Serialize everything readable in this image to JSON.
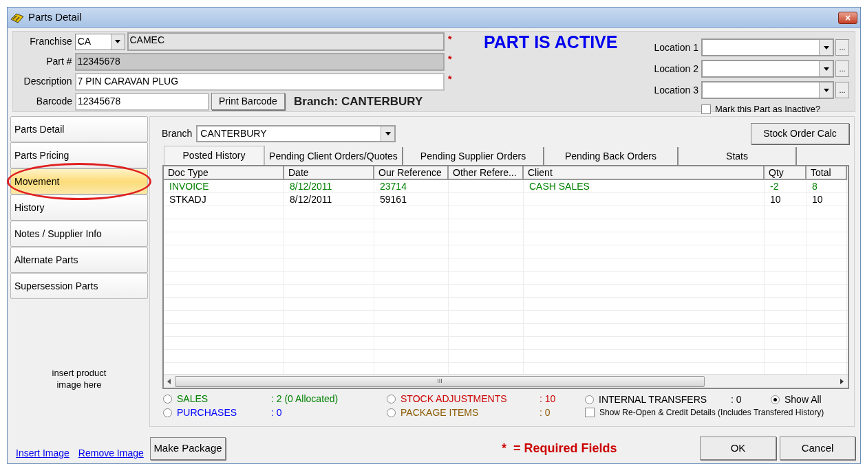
{
  "window": {
    "title": "Parts Detail",
    "close": "×"
  },
  "header": {
    "required_mark": "*",
    "franchise": {
      "label": "Franchise",
      "code": "CA",
      "name": "CAMEC",
      "required": true
    },
    "part_number": {
      "label": "Part #",
      "value": "12345678",
      "required": true
    },
    "description": {
      "label": "Description",
      "value": "7 PIN CARAVAN PLUG",
      "required": true
    },
    "barcode": {
      "label": "Barcode",
      "value": "12345678"
    },
    "print_barcode": "Print Barcode",
    "branch_text": "Branch: CANTERBURY",
    "status": "PART IS ACTIVE",
    "locations": [
      {
        "label": "Location 1",
        "browse": "..."
      },
      {
        "label": "Location 2",
        "browse": "..."
      },
      {
        "label": "Location 3",
        "browse": "..."
      }
    ],
    "inactive": {
      "label": "Mark this Part as Inactive?",
      "checked": false
    }
  },
  "sidebar": {
    "items": [
      {
        "label": "Parts Detail",
        "selected": false
      },
      {
        "label": "Parts Pricing",
        "selected": false
      },
      {
        "label": "Movement",
        "selected": true,
        "circled": true
      },
      {
        "label": "History",
        "selected": false
      },
      {
        "label": "Notes / Supplier Info",
        "selected": false
      },
      {
        "label": "Alternate Parts",
        "selected": false
      },
      {
        "label": "Supersession Parts",
        "selected": false
      }
    ],
    "image_placeholder": [
      "insert product",
      "image here"
    ],
    "links": [
      "Insert Image",
      "Remove Image"
    ]
  },
  "branch": {
    "label": "Branch",
    "value": "CANTERBURY"
  },
  "stock_order_calc": "Stock Order Calc",
  "tabs": [
    {
      "label": "Posted History",
      "selected": true
    },
    {
      "label": "Pending Client Orders/Quotes",
      "selected": false
    },
    {
      "label": "Pending Supplier Orders",
      "selected": false
    },
    {
      "label": "Pending Back Orders",
      "selected": false
    },
    {
      "label": "Stats",
      "selected": false
    }
  ],
  "table": {
    "columns": [
      "Doc Type",
      "Date",
      "Our Reference",
      "Other Refere...",
      "Client",
      "Qty",
      "Total"
    ],
    "rows": [
      {
        "color": "#008000",
        "cells": [
          "INVOICE",
          "8/12/2011",
          "23714",
          "",
          "CASH SALES",
          "-2",
          "8"
        ]
      },
      {
        "color": "#000000",
        "cells": [
          "STKADJ",
          "8/12/2011",
          "59161",
          "",
          "",
          "10",
          "10"
        ]
      }
    ],
    "scroll_thumb": "III"
  },
  "filters": [
    {
      "label": "SALES",
      "value": ": 2 (0 Allocated)",
      "color": "#008000",
      "selected": false
    },
    {
      "label": "PURCHASES",
      "value": ": 0",
      "color": "#0000ff",
      "selected": false
    },
    {
      "label": "STOCK ADJUSTMENTS",
      "value": ": 10",
      "color": "#cc0000",
      "selected": false
    },
    {
      "label": "PACKAGE ITEMS",
      "value": ": 0",
      "color": "#8b5a00",
      "selected": false
    },
    {
      "label": "INTERNAL TRANSFERS",
      "value": ": 0",
      "color": "#000000",
      "selected": false
    },
    {
      "label": "Show All",
      "color": "#000000",
      "selected": true
    }
  ],
  "reopen": {
    "label": "Show Re-Open & Credit Details (Includes Transfered History)",
    "checked": false
  },
  "footer": {
    "make_package": "Make Package",
    "required_note": {
      "mark": "*",
      "text": "= Required Fields"
    },
    "ok": "OK",
    "cancel": "Cancel"
  }
}
